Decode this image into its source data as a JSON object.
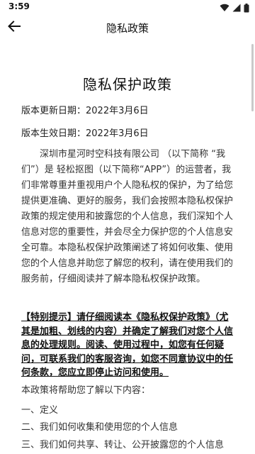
{
  "status_bar": {
    "time": "3:59",
    "icons": [
      "wifi-icon",
      "cellular-signal-icon",
      "battery-icon"
    ]
  },
  "app_bar": {
    "title": "隐私政策",
    "back_icon": "arrow-left-icon"
  },
  "document": {
    "title": "隐私保护政策",
    "updated": "版本更新日期：2022年3月6日",
    "effective": "版本生效日期：2022年3月6日",
    "intro": "深圳市星河时空科技有限公司 （以下简称 “我们”）是 轻松抠图（以下简称“APP”）的运营者，我们非常尊重并重视用户个人隐私权的保护，为了给您提供更准确、更好的服务，我们会按照本隐私权保护政策的规定使用和披露您的个人信息，我们深知个人信息对您的重要性，并会尽全力保护您的个人信息安全可靠。本隐私权保护政策阐述了将如何收集、使用您的个人信息并助您了解您的权利，请在使用我们的服务前，仔细阅读并了解本隐私权保护政策。",
    "notice": "【特别提示】请仔细阅读本《隐私权保护政策》（尤其是加粗、划线的内容）并确定了解我们对您个人信息的处理规则。阅读、使用过程中，如您有任何疑问，可联系我们的客服咨询，如您不同意协议中的任何条款，您应立即停止访问和使用。",
    "lead": "本政策将帮助您了解以下内容：",
    "toc": [
      "一、定义",
      "二、我们如何收集和使用您的个人信息",
      "三、我们如何共享、转让、公开披露您的个人信息"
    ]
  }
}
